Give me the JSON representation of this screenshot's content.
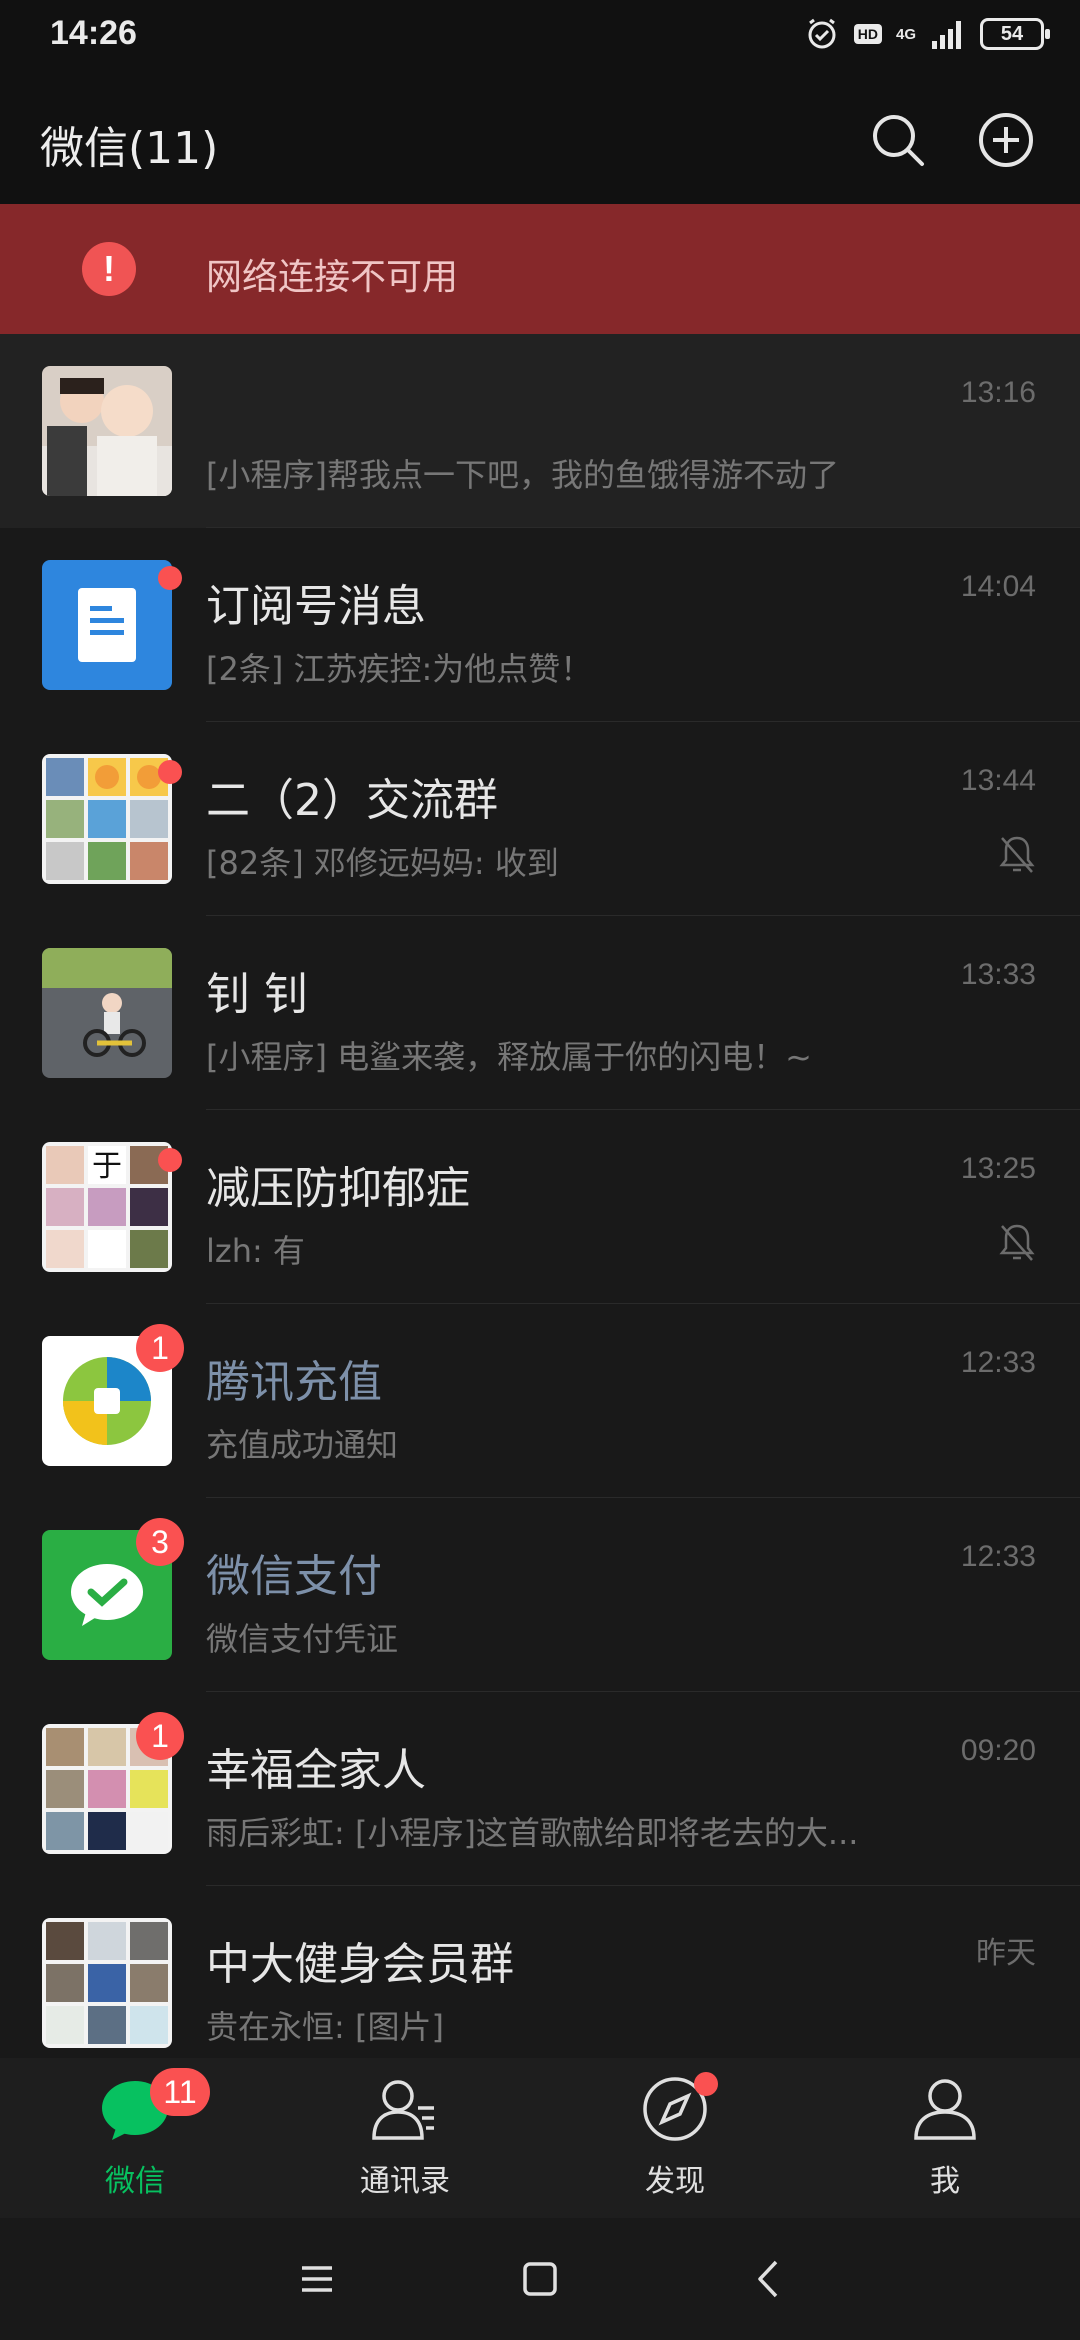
{
  "status_bar": {
    "time": "14:26",
    "network": "4G",
    "hd": "HD",
    "battery": "54",
    "icons": [
      "alarm-icon",
      "hd-icon",
      "signal-icon",
      "battery-icon"
    ]
  },
  "header": {
    "title": "微信(11)",
    "icons": [
      "search-icon",
      "add-circle-icon"
    ]
  },
  "banner": {
    "text": "网络连接不可用",
    "icon": "warning-icon",
    "color": "#86282a"
  },
  "chats": [
    {
      "name": "",
      "preview": "[小程序]帮我点一下吧，我的鱼饿得游不动了",
      "time": "13:16",
      "pinned": true
    },
    {
      "name": "订阅号消息",
      "preview": "[2条] 江苏疾控:为他点赞！",
      "time": "14:04",
      "dot": true
    },
    {
      "name": "二（2）交流群",
      "preview": "[82条] 邓修远妈妈: 收到",
      "time": "13:44",
      "dot": true,
      "muted": true
    },
    {
      "name": "钊 钊",
      "preview": "[小程序] 电鲨来袭，释放属于你的闪电！~",
      "time": "13:33"
    },
    {
      "name": "减压防抑郁症",
      "preview": "lzh: 有",
      "time": "13:25",
      "dot": true,
      "muted": true
    },
    {
      "name": "腾讯充值",
      "preview": "充值成功通知",
      "time": "12:33",
      "badge": "1",
      "service": true
    },
    {
      "name": "微信支付",
      "preview": "微信支付凭证",
      "time": "12:33",
      "badge": "3",
      "service": true
    },
    {
      "name": "幸福全家人",
      "preview": "雨后彩虹: [小程序]这首歌献给即将老去的大...",
      "time": "09:20",
      "badge": "1"
    },
    {
      "name": "中大健身会员群",
      "preview": "贵在永恒: [图片]",
      "time": "昨天"
    }
  ],
  "tabs": [
    {
      "label": "微信",
      "badge": "11",
      "active": true
    },
    {
      "label": "通讯录"
    },
    {
      "label": "发现",
      "dot": true
    },
    {
      "label": "我"
    }
  ],
  "colors": {
    "accent": "#07c160",
    "badge": "#fa5151",
    "background": "#191919",
    "service_name": "#7d90a9"
  }
}
